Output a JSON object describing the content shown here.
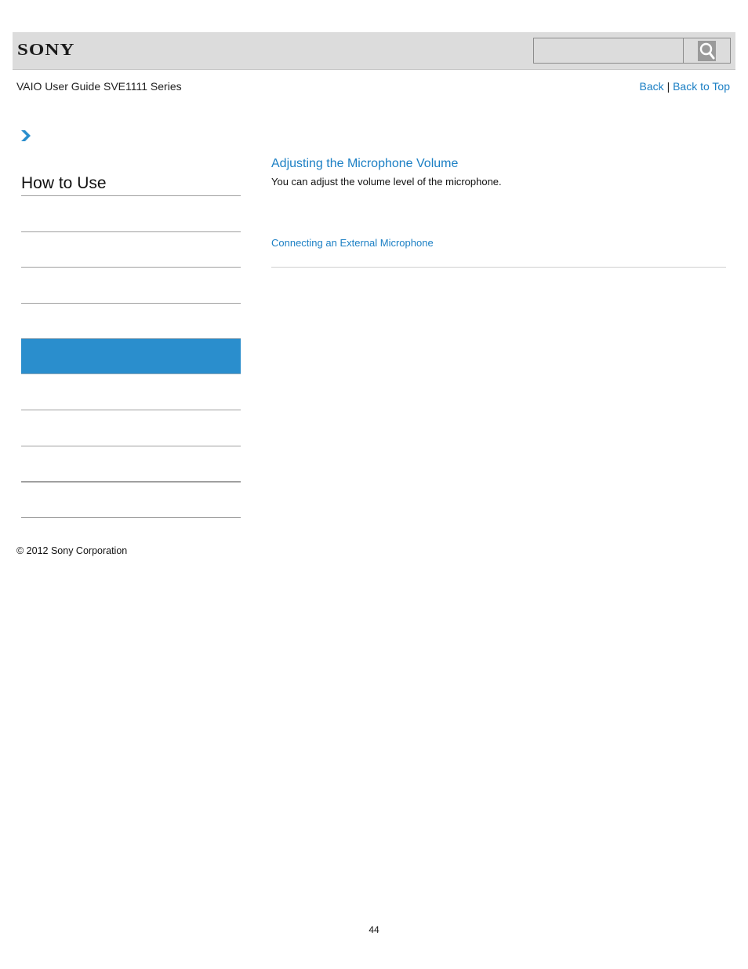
{
  "header": {
    "logo": "SONY",
    "search": {
      "value": "",
      "placeholder": ""
    },
    "search_icon": "magnifier-icon"
  },
  "subheader": {
    "guide_title": "VAIO User Guide SVE1111 Series",
    "back_label": "Back",
    "separator": "|",
    "back_to_top_label": "Back to Top"
  },
  "sidebar": {
    "breadcrumb_icon": "chevron-right-icon",
    "title": "How to Use",
    "items": [
      {
        "label": "",
        "active": false
      },
      {
        "label": "",
        "active": false
      },
      {
        "label": "",
        "active": false
      },
      {
        "label": "",
        "active": true
      },
      {
        "label": "",
        "active": false
      },
      {
        "label": "",
        "active": false
      },
      {
        "label": "",
        "active": false
      },
      {
        "label": "",
        "active": false
      }
    ],
    "active_color": "#2a8ecd"
  },
  "main": {
    "topic_title": "Adjusting the Microphone Volume",
    "topic_description": "You can adjust the volume level of the microphone.",
    "related_link": "Connecting an External Microphone"
  },
  "footer": {
    "copyright": "© 2012 Sony Corporation",
    "page_number": "44"
  },
  "colors": {
    "link": "#1b7fc4",
    "header_bg": "#dcdcdc"
  }
}
